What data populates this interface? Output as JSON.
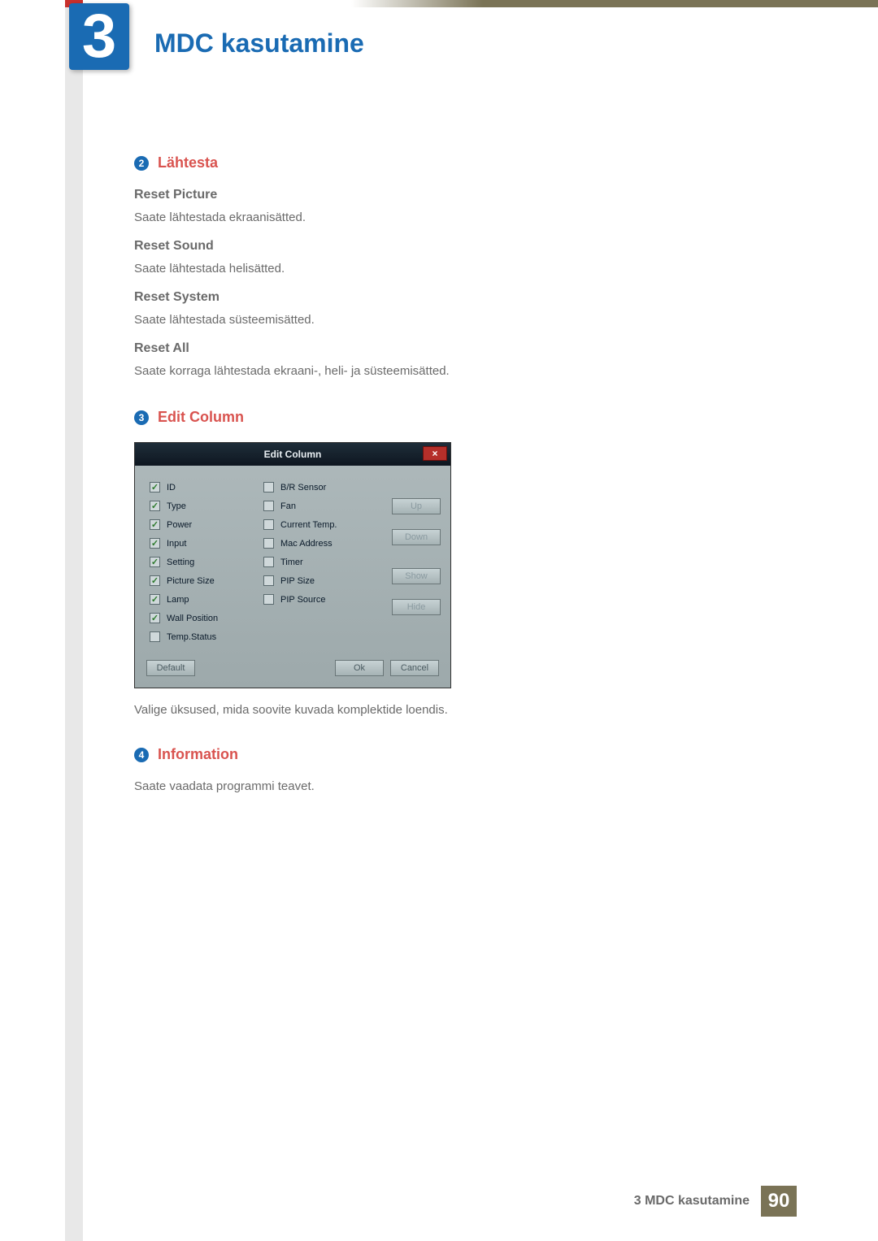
{
  "chapter": {
    "number": "3",
    "title": "MDC kasutamine"
  },
  "section2": {
    "num": "2",
    "title": "Lähtesta",
    "items": [
      {
        "h": "Reset Picture",
        "t": "Saate lähtestada ekraanisätted."
      },
      {
        "h": "Reset Sound",
        "t": "Saate lähtestada helisätted."
      },
      {
        "h": "Reset System",
        "t": "Saate lähtestada süsteemisätted."
      },
      {
        "h": "Reset All",
        "t": "Saate korraga lähtestada ekraani-, heli- ja süsteemisätted."
      }
    ]
  },
  "section3": {
    "num": "3",
    "title": "Edit Column",
    "caption": "Valige üksused, mida soovite kuvada komplektide loendis.",
    "dialog": {
      "title": "Edit Column",
      "close": "×",
      "col1": [
        {
          "label": "ID",
          "checked": true
        },
        {
          "label": "Type",
          "checked": true
        },
        {
          "label": "Power",
          "checked": true
        },
        {
          "label": "Input",
          "checked": true
        },
        {
          "label": "Setting",
          "checked": true
        },
        {
          "label": "Picture Size",
          "checked": true
        },
        {
          "label": "Lamp",
          "checked": true
        },
        {
          "label": "Wall Position",
          "checked": true
        },
        {
          "label": "Temp.Status",
          "checked": false
        }
      ],
      "col2": [
        {
          "label": "B/R Sensor",
          "checked": false
        },
        {
          "label": "Fan",
          "checked": false
        },
        {
          "label": "Current Temp.",
          "checked": false
        },
        {
          "label": "Mac Address",
          "checked": false
        },
        {
          "label": "Timer",
          "checked": false
        },
        {
          "label": "PIP Size",
          "checked": false
        },
        {
          "label": "PIP Source",
          "checked": false
        }
      ],
      "buttons": {
        "up": "Up",
        "down": "Down",
        "show": "Show",
        "hide": "Hide"
      },
      "footer": {
        "default": "Default",
        "ok": "Ok",
        "cancel": "Cancel"
      }
    }
  },
  "section4": {
    "num": "4",
    "title": "Information",
    "text": "Saate vaadata programmi teavet."
  },
  "footer": {
    "label": "3 MDC kasutamine",
    "page": "90"
  }
}
